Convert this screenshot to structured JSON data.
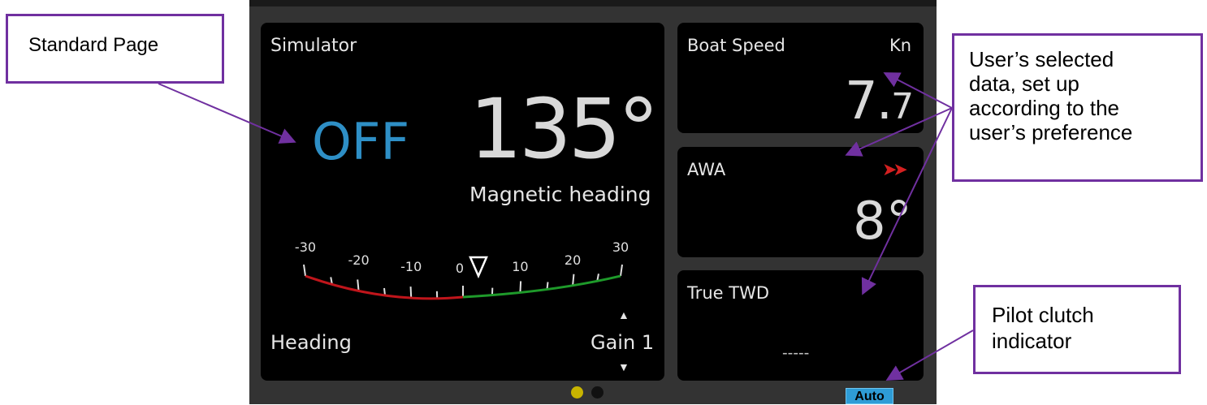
{
  "callouts": {
    "standard_page": "Standard Page",
    "user_data": "User’s selected\ndata, set up\naccording to the\nuser’s preference",
    "pilot_clutch": "Pilot clutch\nindicator"
  },
  "main": {
    "title": "Simulator",
    "mode_state": "OFF",
    "heading_value": "135°",
    "heading_caption": "Magnetic heading",
    "mode_label": "Heading",
    "gain_label": "Gain 1",
    "gain_up_icon": "triangle-up-icon",
    "gain_down_icon": "triangle-down-icon",
    "scale": {
      "ticks": [
        "-30",
        "-20",
        "-10",
        "0",
        "10",
        "20",
        "30"
      ],
      "pointer_value": 0,
      "port_color": "#c0151b",
      "starboard_color": "#1e9a2a"
    }
  },
  "boat_speed": {
    "title": "Boat Speed",
    "unit": "Kn",
    "value_int": "7.",
    "value_dec": "7"
  },
  "awa": {
    "title": "AWA",
    "indicator": "➤➤",
    "indicator_icon": "double-arrow-right-icon",
    "value": "8°"
  },
  "true_twd": {
    "title": "True TWD",
    "value": "-----"
  },
  "footer": {
    "auto_label": "Auto",
    "page_dots": [
      "active",
      "inactive"
    ]
  },
  "colors": {
    "off_blue": "#2e8fc6",
    "callout_border": "#7030a0",
    "awa_arrow": "#d42020",
    "dot_active": "#c8b400",
    "auto_bg": "#2e9cd6"
  }
}
